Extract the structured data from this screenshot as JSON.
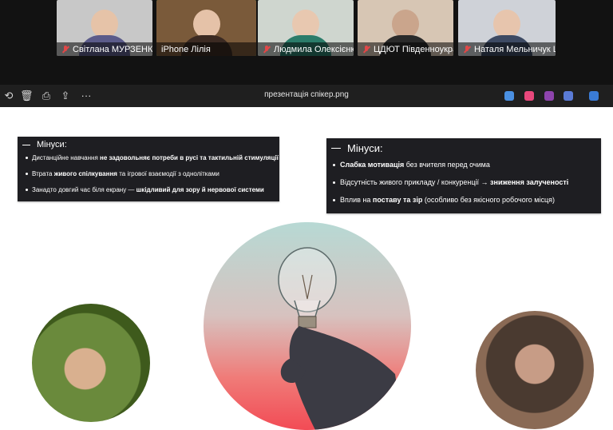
{
  "participants": [
    {
      "name": "Світлана МУРЗЕНКО",
      "muted": true,
      "active": false,
      "bg": "#c8c8c8",
      "skin": "#e6c3a8",
      "top": "#5b5b8a"
    },
    {
      "name": "iPhone Лілія",
      "muted": false,
      "active": true,
      "bg": "#7a5a3a",
      "skin": "#e5c2a8",
      "top": "#3b2a22"
    },
    {
      "name": "Людмила Олексієнко",
      "muted": true,
      "active": false,
      "bg": "#cfd6cf",
      "skin": "#e8c8b0",
      "top": "#2b7c6a"
    },
    {
      "name": "ЦДЮТ Південноукраї...",
      "muted": true,
      "active": false,
      "bg": "#d7c6b4",
      "skin": "#caa58c",
      "top": "#2a2a2a"
    },
    {
      "name": "Наталя Мельничук Ц...",
      "muted": true,
      "active": false,
      "bg": "#cfd2d8",
      "skin": "#e7c5ad",
      "top": "#3d4a63"
    }
  ],
  "viewer": {
    "file_title": "презентація спікер.png",
    "more_label": "···",
    "left_icons": [
      "rotate-icon",
      "delete-icon",
      "print-icon",
      "share-icon",
      "more-icon"
    ],
    "app_icon_colors": [
      "#4a90e2",
      "#e9487c",
      "#8e44ad",
      "#5a7bd6",
      "#3a7bd5"
    ]
  },
  "slide": {
    "left_box": {
      "heading": "Мінуси:",
      "items": [
        {
          "pre": "Дистанційне навчання ",
          "bold": "не задовольняє потреби в русі та тактильній стимуляції",
          "post": ""
        },
        {
          "pre": "Втрата ",
          "bold": "живого спілкування",
          "post": " та ігрової взаємодії з однолітками"
        },
        {
          "pre": "Занадто довгий час біля екрану — ",
          "bold": "шкідливий для зору й нервової системи",
          "post": ""
        }
      ]
    },
    "right_box": {
      "heading": "Мінуси:",
      "items": [
        {
          "pre": "",
          "bold": "Слабка мотивація",
          "post": " без вчителя перед очима"
        },
        {
          "pre": "Відсутність живого прикладу / конкуренції → ",
          "bold": "зниження залученості",
          "post": ""
        },
        {
          "pre": "Вплив на ",
          "bold": "поставу та зір",
          "post": " (особливо без якісного робочого місця)"
        }
      ]
    }
  }
}
